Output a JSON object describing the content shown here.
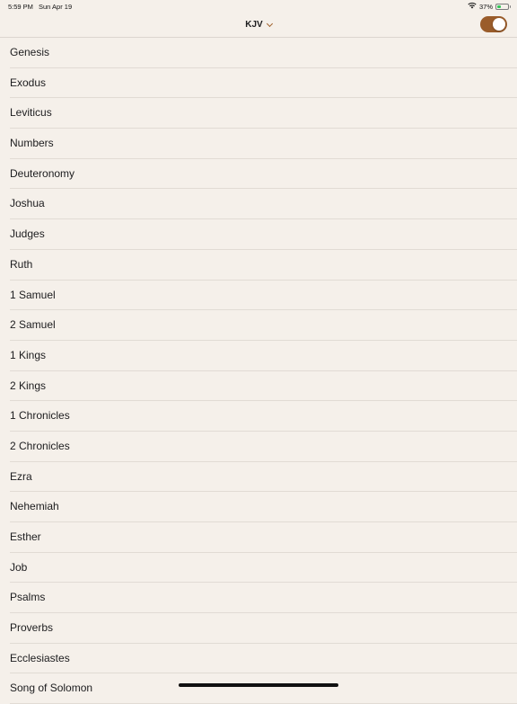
{
  "status_bar": {
    "time": "5:59 PM",
    "date": "Sun Apr 19",
    "battery_percent": "37%",
    "battery_level": 0.37,
    "battery_color": "#34c759"
  },
  "nav": {
    "title": "KJV",
    "dropdown_icon": "chevron-down-icon",
    "toggle_on": true,
    "toggle_color": "#9a5c2a"
  },
  "books": [
    "Genesis",
    "Exodus",
    "Leviticus",
    "Numbers",
    "Deuteronomy",
    "Joshua",
    "Judges",
    "Ruth",
    "1 Samuel",
    "2 Samuel",
    "1 Kings",
    "2 Kings",
    "1 Chronicles",
    "2 Chronicles",
    "Ezra",
    "Nehemiah",
    "Esther",
    "Job",
    "Psalms",
    "Proverbs",
    "Ecclesiastes",
    "Song of Solomon"
  ],
  "colors": {
    "background": "#f5f0ea",
    "accent": "#a0622d"
  }
}
